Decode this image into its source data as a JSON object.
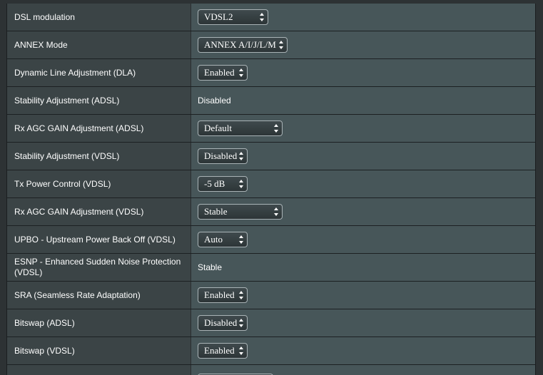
{
  "rows": [
    {
      "label": "DSL modulation",
      "kind": "select",
      "value": "VDSL2"
    },
    {
      "label": "ANNEX Mode",
      "kind": "select",
      "value": "ANNEX A/I/J/L/M"
    },
    {
      "label": "Dynamic Line Adjustment (DLA)",
      "kind": "select",
      "value": "Enabled"
    },
    {
      "label": "Stability Adjustment (ADSL)",
      "kind": "text",
      "value": "Disabled"
    },
    {
      "label": "Rx AGC GAIN Adjustment (ADSL)",
      "kind": "select",
      "value": "Default"
    },
    {
      "label": "Stability Adjustment (VDSL)",
      "kind": "select",
      "value": "Disabled"
    },
    {
      "label": "Tx Power Control (VDSL)",
      "kind": "select",
      "value": "-5 dB"
    },
    {
      "label": "Rx AGC GAIN Adjustment (VDSL)",
      "kind": "select",
      "value": "Stable"
    },
    {
      "label": "UPBO - Upstream Power Back Off (VDSL)",
      "kind": "select",
      "value": "Auto"
    },
    {
      "label": "ESNP - Enhanced Sudden Noise Protection (VDSL)",
      "kind": "text",
      "value": "Stable"
    },
    {
      "label": "SRA (Seamless Rate Adaptation)",
      "kind": "select",
      "value": "Enabled"
    },
    {
      "label": "Bitswap (ADSL)",
      "kind": "select",
      "value": "Disabled"
    },
    {
      "label": "Bitswap (VDSL)",
      "kind": "select",
      "value": "Enabled"
    }
  ]
}
